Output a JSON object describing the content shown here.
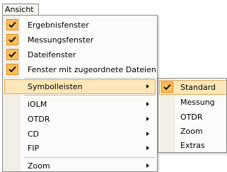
{
  "menu_bar": {
    "ansicht_label": "Ansicht"
  },
  "menu": {
    "items": [
      {
        "label": "Ergebnisfenster",
        "checked": true
      },
      {
        "label": "Messungsfenster",
        "checked": true
      },
      {
        "label": "Dateifenster",
        "checked": true
      },
      {
        "label": "Fenster mit zugeordnete Dateien",
        "checked": true
      },
      {
        "label": "Symbolleisten",
        "submenu": true,
        "highlighted": true
      },
      {
        "label": "iOLM",
        "submenu": true
      },
      {
        "label": "OTDR",
        "submenu": true
      },
      {
        "label": "CD",
        "submenu": true
      },
      {
        "label": "FIP",
        "submenu": true
      },
      {
        "label": "Zoom",
        "submenu": true
      }
    ]
  },
  "submenu": {
    "items": [
      {
        "label": "Standard",
        "checked": true,
        "highlighted": true
      },
      {
        "label": "Messung"
      },
      {
        "label": "OTDR"
      },
      {
        "label": "Zoom"
      },
      {
        "label": "Extras"
      }
    ]
  },
  "colors": {
    "highlight_fill": "#fde7b8",
    "highlight_border": "#e4a65a",
    "check_fill": "#fbbf5a",
    "check_border": "#e08a1e",
    "gutter": "#f1efe6"
  },
  "icons": {
    "check": "check-icon",
    "submenu_arrow": "chevron-right-icon"
  }
}
